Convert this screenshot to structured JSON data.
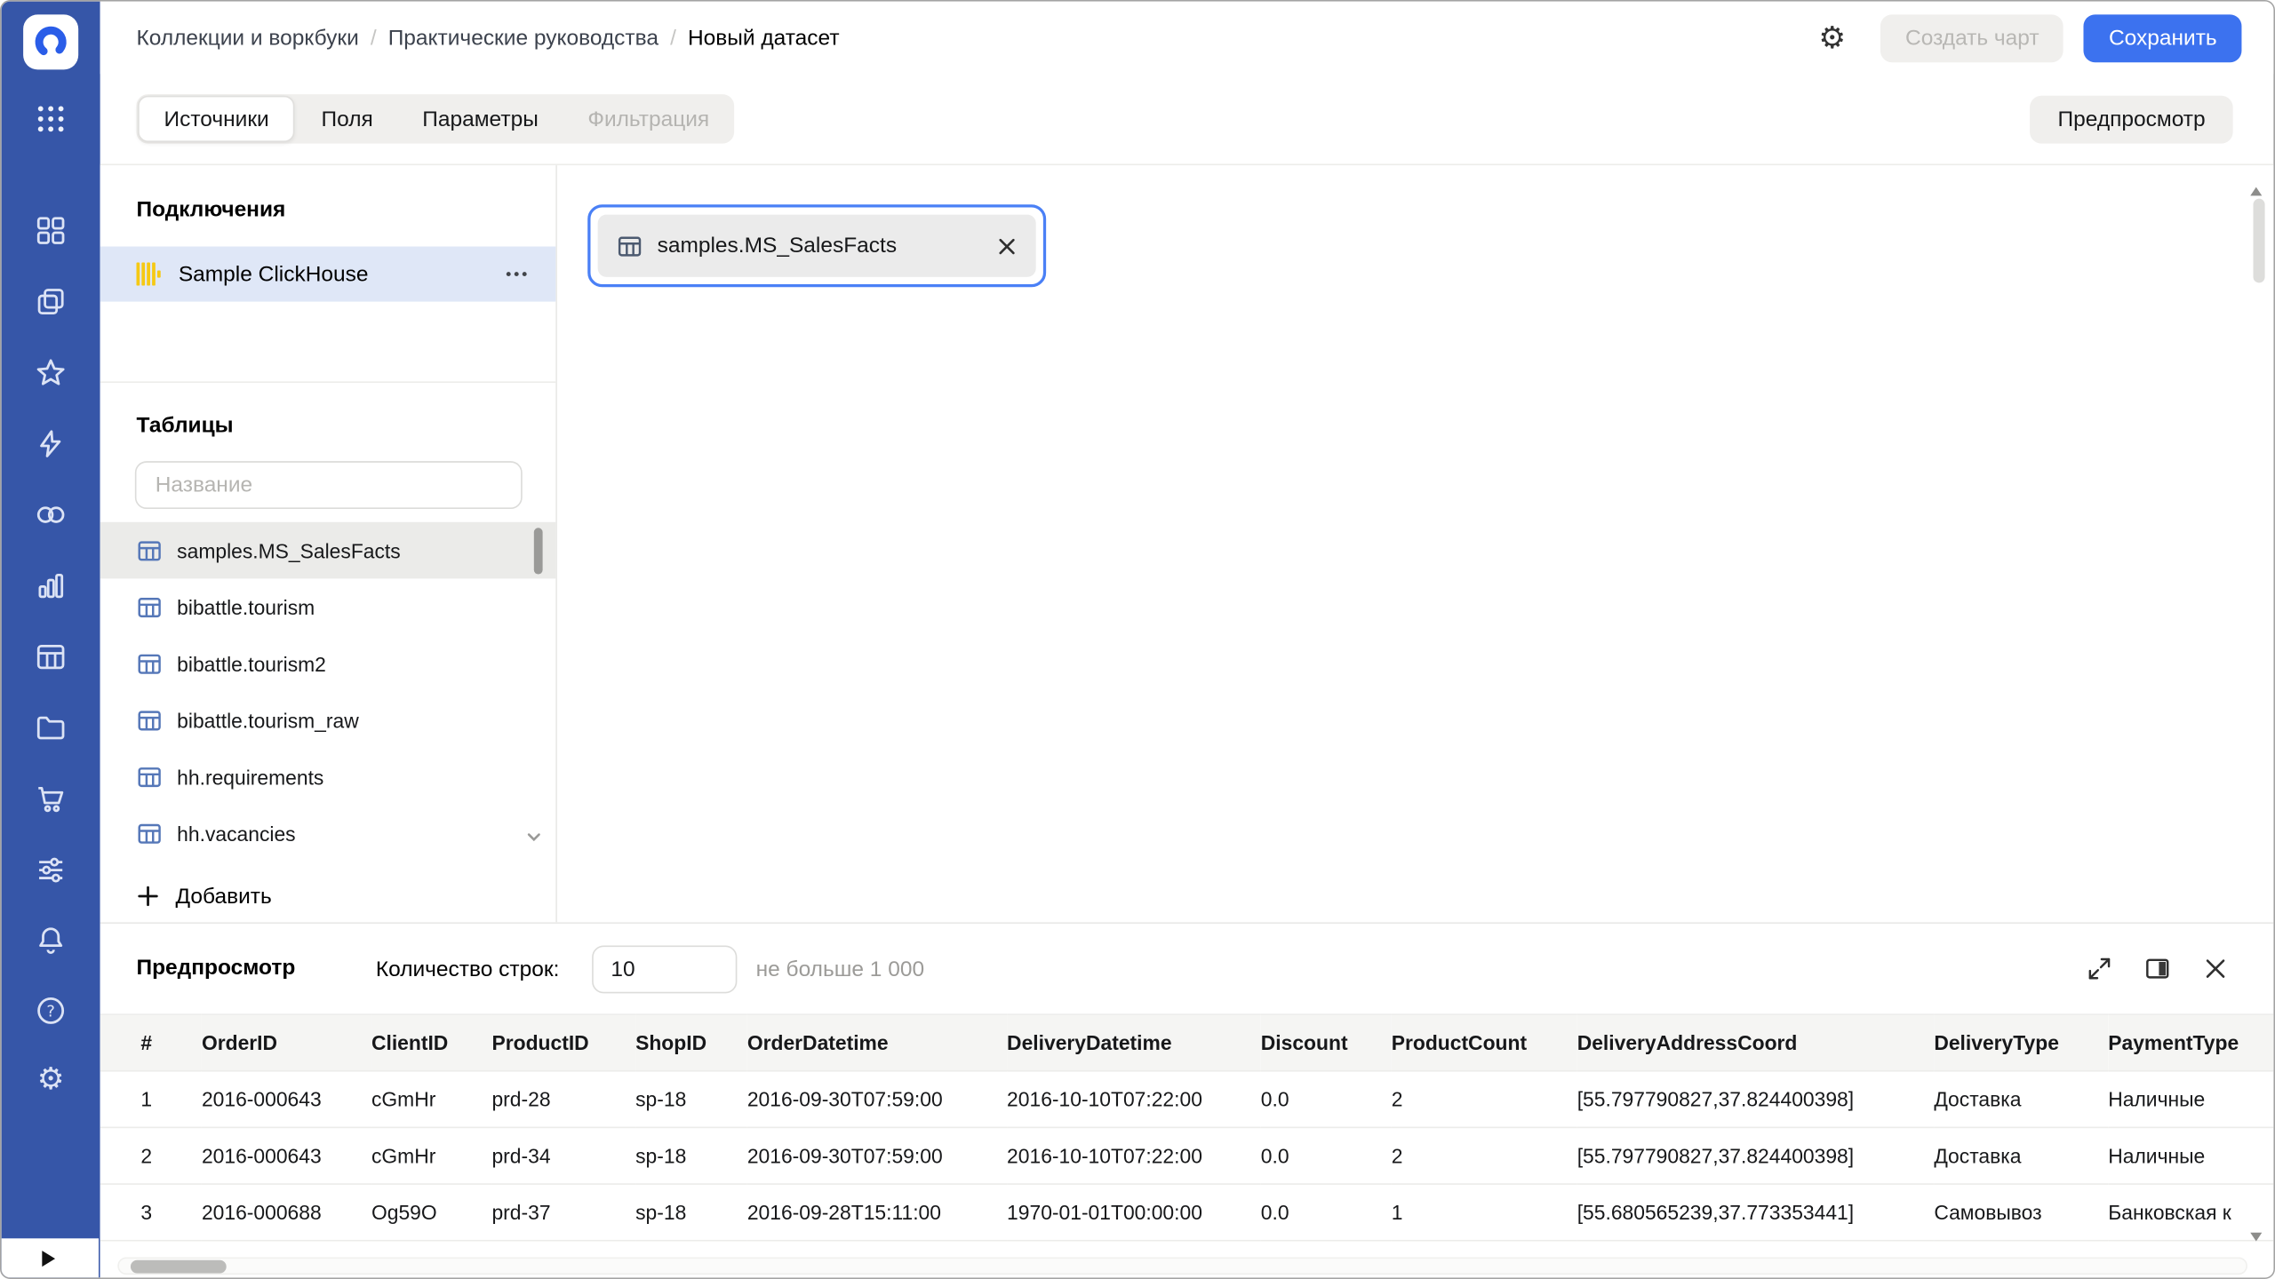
{
  "header": {
    "breadcrumbs": [
      "Коллекции и воркбуки",
      "Практические руководства",
      "Новый датасет"
    ],
    "separator": "/",
    "create_chart_label": "Создать чарт",
    "save_label": "Сохранить"
  },
  "tabs": {
    "items": [
      {
        "label": "Источники",
        "state": "active"
      },
      {
        "label": "Поля",
        "state": "normal"
      },
      {
        "label": "Параметры",
        "state": "normal"
      },
      {
        "label": "Фильтрация",
        "state": "disabled"
      }
    ],
    "preview_button_label": "Предпросмотр"
  },
  "connections_panel": {
    "title": "Подключения",
    "connection_name": "Sample ClickHouse"
  },
  "tables_panel": {
    "title": "Таблицы",
    "search_placeholder": "Название",
    "items": [
      "samples.MS_SalesFacts",
      "bibattle.tourism",
      "bibattle.tourism2",
      "bibattle.tourism_raw",
      "hh.requirements",
      "hh.vacancies"
    ],
    "selected_index": 0,
    "add_label": "Добавить"
  },
  "canvas": {
    "dataset_chip_label": "samples.MS_SalesFacts"
  },
  "preview": {
    "title": "Предпросмотр",
    "rows_label": "Количество строк:",
    "rows_value": "10",
    "rows_hint": "не больше 1 000",
    "table": {
      "columns": [
        "#",
        "OrderID",
        "ClientID",
        "ProductID",
        "ShopID",
        "OrderDatetime",
        "DeliveryDatetime",
        "Discount",
        "ProductCount",
        "DeliveryAddressCoord",
        "DeliveryType",
        "PaymentType"
      ],
      "rows": [
        [
          "1",
          "2016-000643",
          "cGmHr",
          "prd-28",
          "sp-18",
          "2016-09-30T07:59:00",
          "2016-10-10T07:22:00",
          "0.0",
          "2",
          "[55.797790827,37.824400398]",
          "Доставка",
          "Наличные"
        ],
        [
          "2",
          "2016-000643",
          "cGmHr",
          "prd-34",
          "sp-18",
          "2016-09-30T07:59:00",
          "2016-10-10T07:22:00",
          "0.0",
          "2",
          "[55.797790827,37.824400398]",
          "Доставка",
          "Наличные"
        ],
        [
          "3",
          "2016-000688",
          "Og59O",
          "prd-37",
          "sp-18",
          "2016-09-28T15:11:00",
          "1970-01-01T00:00:00",
          "0.0",
          "1",
          "[55.680565239,37.773353441]",
          "Самовывоз",
          "Банковская к"
        ]
      ]
    }
  },
  "colors": {
    "accent_blue": "#3c72ef",
    "rail_blue": "#3656a8",
    "chip_border_blue": "#4a80f6",
    "selection_blue": "#dfe7f7",
    "clickhouse_yellow": "#f6c913"
  }
}
